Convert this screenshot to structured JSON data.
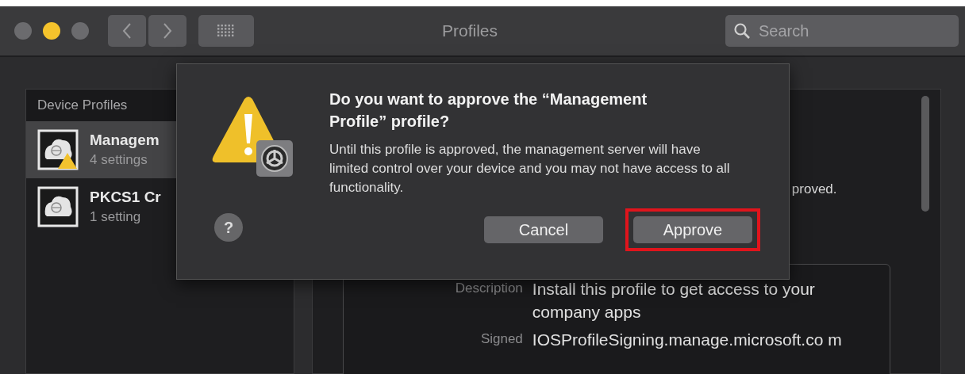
{
  "window": {
    "title": "Profiles",
    "traffic_lights": [
      {
        "kind": "close"
      },
      {
        "kind": "minimize"
      },
      {
        "kind": "zoom"
      }
    ]
  },
  "search": {
    "placeholder": "Search"
  },
  "sidebar": {
    "header": "Device Profiles",
    "items": [
      {
        "name": "Managem",
        "count": "4 settings",
        "selected": true,
        "warning": true
      },
      {
        "name": "PKCS1 Cr",
        "count": "1 setting",
        "selected": false,
        "warning": false
      }
    ]
  },
  "detail": {
    "partial_text": "proved.",
    "fields": [
      {
        "label": "Description",
        "value": "Install this profile to get access to your company apps"
      },
      {
        "label": "Signed",
        "value": "IOSProfileSigning.manage.microsoft.co m"
      }
    ]
  },
  "dialog": {
    "title": "Do you want to approve the “Management Profile” profile?",
    "message": "Until this profile is approved, the management server will have limited control over your device and you may not have access to all functionality.",
    "help": "?",
    "buttons": [
      {
        "label": "Cancel",
        "highlighted": false
      },
      {
        "label": "Approve",
        "highlighted": true
      }
    ]
  }
}
